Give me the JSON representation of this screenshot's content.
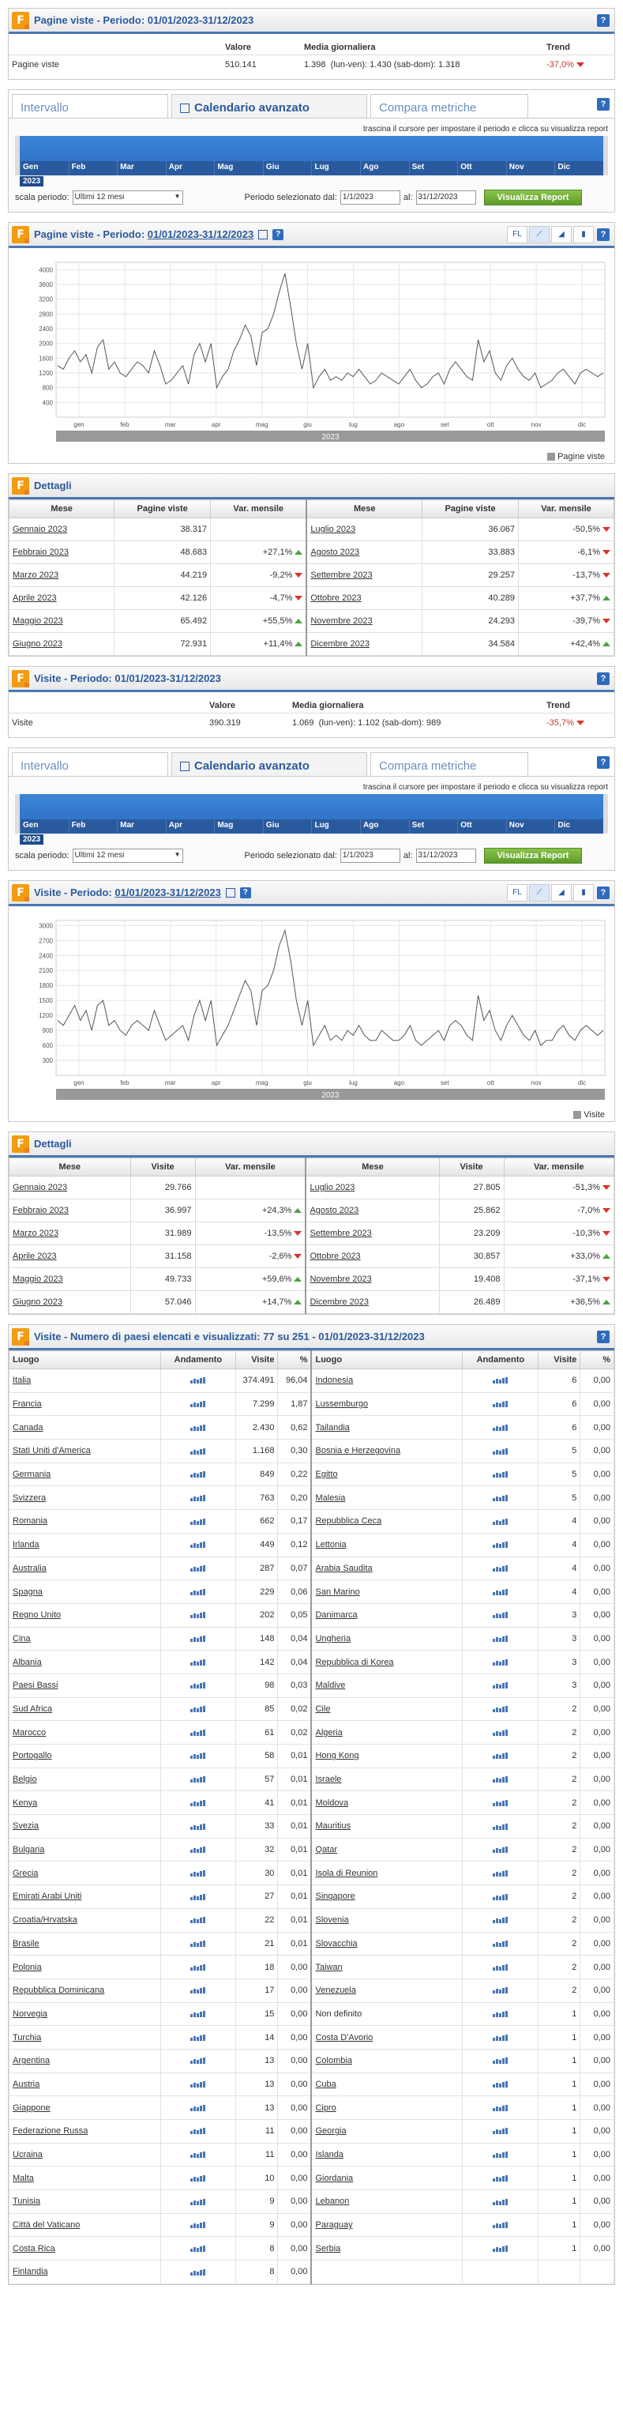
{
  "pv_summary": {
    "title": "Pagine viste - Periodo: 01/01/2023-31/12/2023",
    "headers": [
      "Valore",
      "Media giornaliera",
      "Trend"
    ],
    "label": "Pagine viste",
    "valore": "510.141",
    "media": "1.398",
    "media_detail": "(lun-ven): 1.430   (sab-dom): 1.318",
    "trend": "-37,0%"
  },
  "tabs": [
    "Intervallo",
    "Calendario avanzato",
    "Compara metriche"
  ],
  "timeline": {
    "hint": "trascina il cursore per impostare il periodo e clicca su visualizza report",
    "months": [
      "Gen",
      "Feb",
      "Mar",
      "Apr",
      "Mag",
      "Giu",
      "Lug",
      "Ago",
      "Set",
      "Ott",
      "Nov",
      "Dic"
    ],
    "year": "2023",
    "scala_label": "scala periodo:",
    "scala_value": "Ultimi 12 mesi",
    "periodo_label": "Periodo selezionato dal:",
    "dal": "1/1/2023",
    "al_label": "al:",
    "al": "31/12/2023",
    "button": "Visualizza Report"
  },
  "pv_chart": {
    "title_prefix": "Pagine viste - Periodo: ",
    "title_period": "01/01/2023-31/12/2023",
    "tools": [
      "FL",
      "line",
      "area",
      "bar"
    ],
    "legend": "Pagine viste"
  },
  "visite_chart": {
    "title_prefix": "Visite - Periodo: ",
    "title_period": "01/01/2023-31/12/2023",
    "tools": [
      "FL",
      "line",
      "area",
      "bar"
    ],
    "legend": "Visite"
  },
  "chart_data": [
    {
      "type": "line",
      "yticks": [
        "4000",
        "3600",
        "3200",
        "2800",
        "2400",
        "2000",
        "1600",
        "1200",
        "800",
        "400"
      ],
      "ylim": [
        0,
        4200
      ],
      "xticks": [
        "gen",
        "feb",
        "mar",
        "apr",
        "mag",
        "giu",
        "lug",
        "ago",
        "set",
        "ott",
        "nov",
        "dic"
      ],
      "year": "2023",
      "series": [
        {
          "name": "Pagine viste",
          "values": [
            1400,
            1300,
            1600,
            1800,
            1500,
            1700,
            1200,
            1900,
            2100,
            1300,
            1500,
            1200,
            1100,
            1300,
            1500,
            1400,
            1200,
            1800,
            1400,
            900,
            1000,
            1200,
            1400,
            900,
            1700,
            2000,
            1500,
            2000,
            800,
            1100,
            1300,
            1800,
            2100,
            2500,
            2200,
            1400,
            2300,
            2400,
            2800,
            3400,
            3900,
            3000,
            2000,
            1300,
            2000,
            800,
            1100,
            1300,
            1000,
            1100,
            1000,
            1200,
            1100,
            1300,
            1100,
            900,
            1000,
            1200,
            1100,
            1000,
            900,
            1100,
            1300,
            1000,
            800,
            900,
            1100,
            1200,
            900,
            1300,
            1500,
            1300,
            1100,
            1000,
            2100,
            1500,
            1800,
            1200,
            1000,
            1400,
            1600,
            1300,
            1100,
            1000,
            1200,
            800,
            900,
            1000,
            1200,
            1300,
            1100,
            900,
            1200,
            1300,
            1200,
            1100,
            1200
          ]
        }
      ]
    },
    {
      "type": "line",
      "yticks": [
        "3000",
        "2700",
        "2400",
        "2100",
        "1800",
        "1500",
        "1200",
        "900",
        "600",
        "300"
      ],
      "ylim": [
        0,
        3100
      ],
      "xticks": [
        "gen",
        "feb",
        "mar",
        "apr",
        "mag",
        "giu",
        "lug",
        "ago",
        "set",
        "ott",
        "nov",
        "dic"
      ],
      "year": "2023",
      "series": [
        {
          "name": "Visite",
          "values": [
            1100,
            1000,
            1200,
            1400,
            1100,
            1300,
            900,
            1400,
            1500,
            1000,
            1100,
            900,
            800,
            1000,
            1100,
            1000,
            900,
            1300,
            1000,
            700,
            800,
            900,
            1000,
            700,
            1200,
            1500,
            1100,
            1500,
            600,
            800,
            1000,
            1300,
            1600,
            1900,
            1700,
            1000,
            1700,
            1800,
            2100,
            2600,
            2900,
            2300,
            1500,
            1000,
            1500,
            600,
            800,
            1000,
            700,
            800,
            700,
            900,
            800,
            1000,
            800,
            700,
            700,
            900,
            800,
            700,
            700,
            800,
            1000,
            700,
            600,
            700,
            800,
            900,
            700,
            1000,
            1100,
            1000,
            800,
            700,
            1600,
            1100,
            1300,
            900,
            700,
            1000,
            1200,
            1000,
            800,
            700,
            900,
            600,
            700,
            700,
            900,
            1000,
            800,
            700,
            900,
            1000,
            900,
            800,
            900
          ]
        }
      ]
    }
  ],
  "pv_details": {
    "title": "Dettagli",
    "headers": [
      "Mese",
      "Pagine viste",
      "Var. mensile",
      "Mese",
      "Pagine viste",
      "Var. mensile"
    ],
    "left": [
      {
        "mese": "Gennaio 2023",
        "val": "38.317",
        "var": "",
        "dir": ""
      },
      {
        "mese": "Febbraio 2023",
        "val": "48.683",
        "var": "+27,1%",
        "dir": "up"
      },
      {
        "mese": "Marzo 2023",
        "val": "44.219",
        "var": "-9,2%",
        "dir": "down"
      },
      {
        "mese": "Aprile 2023",
        "val": "42.126",
        "var": "-4,7%",
        "dir": "down"
      },
      {
        "mese": "Maggio 2023",
        "val": "65.492",
        "var": "+55,5%",
        "dir": "up"
      },
      {
        "mese": "Giugno 2023",
        "val": "72.931",
        "var": "+11,4%",
        "dir": "up"
      }
    ],
    "right": [
      {
        "mese": "Luglio 2023",
        "val": "36.067",
        "var": "-50,5%",
        "dir": "down"
      },
      {
        "mese": "Agosto 2023",
        "val": "33.883",
        "var": "-6,1%",
        "dir": "down"
      },
      {
        "mese": "Settembre 2023",
        "val": "29.257",
        "var": "-13,7%",
        "dir": "down"
      },
      {
        "mese": "Ottobre 2023",
        "val": "40.289",
        "var": "+37,7%",
        "dir": "up"
      },
      {
        "mese": "Novembre 2023",
        "val": "24.293",
        "var": "-39,7%",
        "dir": "down"
      },
      {
        "mese": "Dicembre 2023",
        "val": "34.584",
        "var": "+42,4%",
        "dir": "up"
      }
    ]
  },
  "v_summary": {
    "title": "Visite - Periodo: 01/01/2023-31/12/2023",
    "headers": [
      "Valore",
      "Media giornaliera",
      "Trend"
    ],
    "label": "Visite",
    "valore": "390.319",
    "media": "1.069",
    "media_detail": "(lun-ven): 1.102   (sab-dom): 989",
    "trend": "-35,7%"
  },
  "v_details": {
    "title": "Dettagli",
    "headers": [
      "Mese",
      "Visite",
      "Var. mensile",
      "Mese",
      "Visite",
      "Var. mensile"
    ],
    "left": [
      {
        "mese": "Gennaio 2023",
        "val": "29.766",
        "var": "",
        "dir": ""
      },
      {
        "mese": "Febbraio 2023",
        "val": "36.997",
        "var": "+24,3%",
        "dir": "up"
      },
      {
        "mese": "Marzo 2023",
        "val": "31.989",
        "var": "-13,5%",
        "dir": "down"
      },
      {
        "mese": "Aprile 2023",
        "val": "31.158",
        "var": "-2,6%",
        "dir": "down"
      },
      {
        "mese": "Maggio 2023",
        "val": "49.733",
        "var": "+59,6%",
        "dir": "up"
      },
      {
        "mese": "Giugno 2023",
        "val": "57.046",
        "var": "+14,7%",
        "dir": "up"
      }
    ],
    "right": [
      {
        "mese": "Luglio 2023",
        "val": "27.805",
        "var": "-51,3%",
        "dir": "down"
      },
      {
        "mese": "Agosto 2023",
        "val": "25.862",
        "var": "-7,0%",
        "dir": "down"
      },
      {
        "mese": "Settembre 2023",
        "val": "23.209",
        "var": "-10,3%",
        "dir": "down"
      },
      {
        "mese": "Ottobre 2023",
        "val": "30.857",
        "var": "+33,0%",
        "dir": "up"
      },
      {
        "mese": "Novembre 2023",
        "val": "19.408",
        "var": "-37,1%",
        "dir": "down"
      },
      {
        "mese": "Dicembre 2023",
        "val": "26.489",
        "var": "+36,5%",
        "dir": "up"
      }
    ]
  },
  "paesi": {
    "title": "Visite - Numero di paesi elencati e visualizzati: 77 su 251 - 01/01/2023-31/12/2023",
    "headers": [
      "Luogo",
      "Andamento",
      "Visite",
      "%",
      "Luogo",
      "Andamento",
      "Visite",
      "%"
    ],
    "left": [
      [
        "Italia",
        "374.491",
        "96,04"
      ],
      [
        "Francia",
        "7.299",
        "1,87"
      ],
      [
        "Canada",
        "2.430",
        "0,62"
      ],
      [
        "Stati Uniti d'America",
        "1.168",
        "0,30"
      ],
      [
        "Germania",
        "849",
        "0,22"
      ],
      [
        "Svizzera",
        "763",
        "0,20"
      ],
      [
        "Romania",
        "662",
        "0,17"
      ],
      [
        "Irlanda",
        "449",
        "0,12"
      ],
      [
        "Australia",
        "287",
        "0,07"
      ],
      [
        "Spagna",
        "229",
        "0,06"
      ],
      [
        "Regno Unito",
        "202",
        "0,05"
      ],
      [
        "Cina",
        "148",
        "0,04"
      ],
      [
        "Albania",
        "142",
        "0,04"
      ],
      [
        "Paesi Bassi",
        "98",
        "0,03"
      ],
      [
        "Sud Africa",
        "85",
        "0,02"
      ],
      [
        "Marocco",
        "61",
        "0,02"
      ],
      [
        "Portogallo",
        "58",
        "0,01"
      ],
      [
        "Belgio",
        "57",
        "0,01"
      ],
      [
        "Kenya",
        "41",
        "0,01"
      ],
      [
        "Svezia",
        "33",
        "0,01"
      ],
      [
        "Bulgaria",
        "32",
        "0,01"
      ],
      [
        "Grecia",
        "30",
        "0,01"
      ],
      [
        "Emirati Arabi Uniti",
        "27",
        "0,01"
      ],
      [
        "Croatia/Hrvatska",
        "22",
        "0,01"
      ],
      [
        "Brasile",
        "21",
        "0,01"
      ],
      [
        "Polonia",
        "18",
        "0,00"
      ],
      [
        "Repubblica Dominicana",
        "17",
        "0,00"
      ],
      [
        "Norvegia",
        "15",
        "0,00"
      ],
      [
        "Turchia",
        "14",
        "0,00"
      ],
      [
        "Argentina",
        "13",
        "0,00"
      ],
      [
        "Austria",
        "13",
        "0,00"
      ],
      [
        "Giappone",
        "13",
        "0,00"
      ],
      [
        "Federazione Russa",
        "11",
        "0,00"
      ],
      [
        "Ucraina",
        "11",
        "0,00"
      ],
      [
        "Malta",
        "10",
        "0,00"
      ],
      [
        "Tunisia",
        "9",
        "0,00"
      ],
      [
        "Città del Vaticano",
        "9",
        "0,00"
      ],
      [
        "Costa Rica",
        "8",
        "0,00"
      ],
      [
        "Finlandia",
        "8",
        "0,00"
      ]
    ],
    "right": [
      [
        "Indonesia",
        "6",
        "0,00"
      ],
      [
        "Lussemburgo",
        "6",
        "0,00"
      ],
      [
        "Tailandia",
        "6",
        "0,00"
      ],
      [
        "Bosnia e Herzegovina",
        "5",
        "0,00"
      ],
      [
        "Egitto",
        "5",
        "0,00"
      ],
      [
        "Malesia",
        "5",
        "0,00"
      ],
      [
        "Repubblica Ceca",
        "4",
        "0,00"
      ],
      [
        "Lettonia",
        "4",
        "0,00"
      ],
      [
        "Arabia Saudita",
        "4",
        "0,00"
      ],
      [
        "San Marino",
        "4",
        "0,00"
      ],
      [
        "Danimarca",
        "3",
        "0,00"
      ],
      [
        "Ungheria",
        "3",
        "0,00"
      ],
      [
        "Repubblica di Korea",
        "3",
        "0,00"
      ],
      [
        "Maldive",
        "3",
        "0,00"
      ],
      [
        "Cile",
        "2",
        "0,00"
      ],
      [
        "Algeria",
        "2",
        "0,00"
      ],
      [
        "Hong Kong",
        "2",
        "0,00"
      ],
      [
        "Israele",
        "2",
        "0,00"
      ],
      [
        "Moldova",
        "2",
        "0,00"
      ],
      [
        "Mauritius",
        "2",
        "0,00"
      ],
      [
        "Qatar",
        "2",
        "0,00"
      ],
      [
        "Isola di Reunion",
        "2",
        "0,00"
      ],
      [
        "Singapore",
        "2",
        "0,00"
      ],
      [
        "Slovenia",
        "2",
        "0,00"
      ],
      [
        "Slovacchia",
        "2",
        "0,00"
      ],
      [
        "Taiwan",
        "2",
        "0,00"
      ],
      [
        "Venezuela",
        "2",
        "0,00"
      ],
      [
        "Non definito",
        "1",
        "0,00"
      ],
      [
        "Costa D'Avorio",
        "1",
        "0,00"
      ],
      [
        "Colombia",
        "1",
        "0,00"
      ],
      [
        "Cuba",
        "1",
        "0,00"
      ],
      [
        "Cipro",
        "1",
        "0,00"
      ],
      [
        "Georgia",
        "1",
        "0,00"
      ],
      [
        "Islanda",
        "1",
        "0,00"
      ],
      [
        "Giordania",
        "1",
        "0,00"
      ],
      [
        "Lebanon",
        "1",
        "0,00"
      ],
      [
        "Paraguay",
        "1",
        "0,00"
      ],
      [
        "Serbia",
        "1",
        "0,00"
      ]
    ]
  }
}
